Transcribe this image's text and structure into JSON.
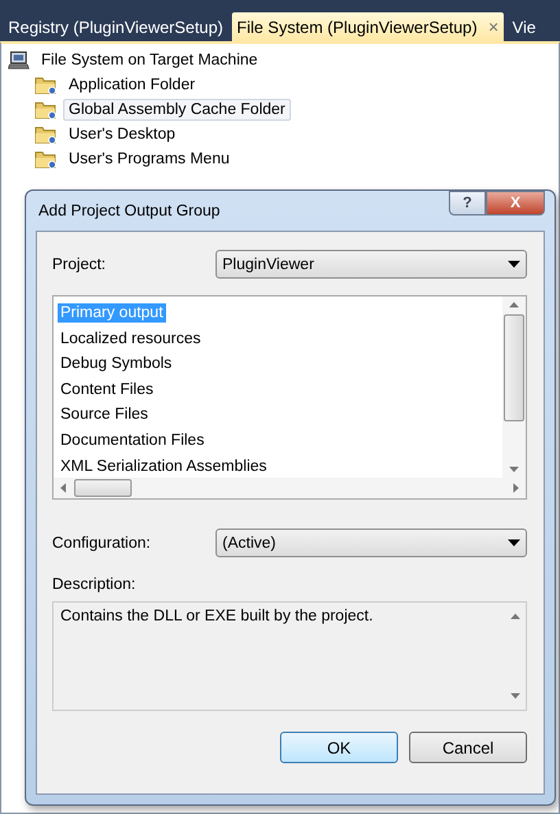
{
  "tabs": [
    {
      "label": "Registry (PluginViewerSetup)",
      "selected": false
    },
    {
      "label": "File System (PluginViewerSetup)",
      "selected": true,
      "close": "×"
    },
    {
      "label": "Vie",
      "selected": false
    }
  ],
  "tree": {
    "label": "File System on Target Machine",
    "children": [
      {
        "label": "Application Folder",
        "selected": false
      },
      {
        "label": "Global Assembly Cache Folder",
        "selected": true
      },
      {
        "label": "User's Desktop",
        "selected": false
      },
      {
        "label": "User's Programs Menu",
        "selected": false
      }
    ]
  },
  "dialog": {
    "title": "Add Project Output Group",
    "help": "?",
    "close": "X",
    "project": {
      "label": "Project:",
      "value": "PluginViewer"
    },
    "outputs": [
      {
        "label": "Primary output",
        "selected": true
      },
      {
        "label": "Localized resources",
        "selected": false
      },
      {
        "label": "Debug Symbols",
        "selected": false
      },
      {
        "label": "Content Files",
        "selected": false
      },
      {
        "label": "Source Files",
        "selected": false
      },
      {
        "label": "Documentation Files",
        "selected": false
      },
      {
        "label": "XML Serialization Assemblies",
        "selected": false
      }
    ],
    "configuration": {
      "label": "Configuration:",
      "value": "(Active)"
    },
    "description": {
      "label": "Description:",
      "text": "Contains the DLL or EXE built by the project."
    },
    "buttons": [
      {
        "label": "OK",
        "default": true
      },
      {
        "label": "Cancel",
        "default": false
      }
    ]
  }
}
